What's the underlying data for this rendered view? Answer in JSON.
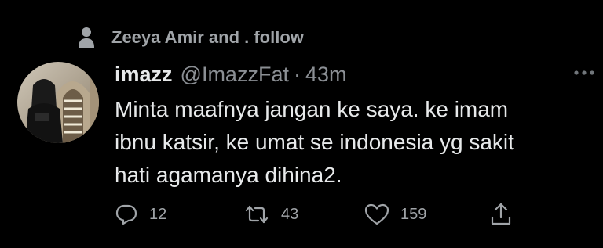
{
  "social_context": {
    "text": "Zeeya Amir and . follow",
    "icon": "person-icon"
  },
  "author": {
    "display_name": "imazz",
    "handle": "@ImazzFat",
    "separator": "·",
    "timestamp": "43m"
  },
  "tweet": {
    "lines": [
      "Minta maafnya jangan ke saya. ke imam",
      "ibnu katsir, ke umat se indonesia yg sakit",
      "hati agamanya dihina2."
    ]
  },
  "actions": {
    "reply_count": "12",
    "retweet_count": "43",
    "like_count": "159"
  },
  "colors": {
    "background": "#000000",
    "primary_text": "#e7e9ea",
    "secondary_text": "#8b8f94"
  }
}
